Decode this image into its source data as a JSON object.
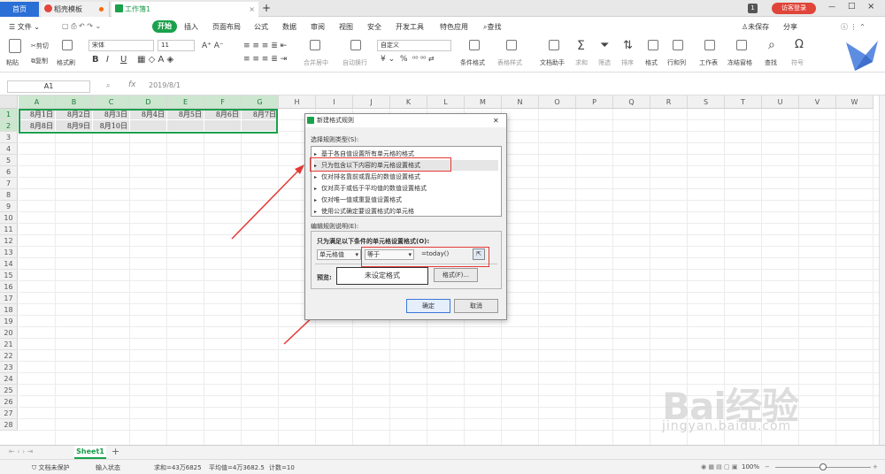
{
  "tabs": {
    "home": "首页",
    "t1": "稻壳模板",
    "t2": "工作簿1",
    "close": "×",
    "add": "+"
  },
  "topright": {
    "badge": "1",
    "login": "访客登录",
    "minimize": "—",
    "maximize": "□"
  },
  "menu": {
    "file": "文件",
    "start": "开始",
    "items": [
      "插入",
      "页面布局",
      "公式",
      "数据",
      "审阅",
      "视图",
      "安全",
      "开发工具",
      "特色应用"
    ],
    "search": "查找",
    "unsaved": "未保存",
    "share": "分享"
  },
  "ribbon": {
    "paste": "粘贴",
    "cut": "剪切",
    "copy": "复制",
    "format_painter": "格式刷",
    "font": "宋体",
    "size": "11",
    "bold": "B",
    "italic": "I",
    "underline": "U",
    "merge": "合并居中",
    "wrap": "自动换行",
    "numfmt": "自定义",
    "percent": "%",
    "cond": "条件格式",
    "table_style": "表格样式",
    "doc_helper": "文档助手",
    "sum": "求和",
    "filter": "筛选",
    "sort": "排序",
    "format": "格式",
    "rowcol": "行和列",
    "worksheet": "工作表",
    "freeze": "冻结窗格",
    "find": "查找",
    "symbol": "符号"
  },
  "formula_bar": {
    "cell_ref": "A1",
    "fx": "fx",
    "value": "2019/8/1"
  },
  "grid": {
    "columns": [
      "A",
      "B",
      "C",
      "D",
      "E",
      "F",
      "G",
      "H",
      "I",
      "J",
      "K",
      "L",
      "M",
      "N",
      "O",
      "P",
      "Q",
      "R",
      "S",
      "T",
      "U",
      "V",
      "W"
    ],
    "rows": [
      "1",
      "2",
      "3",
      "4",
      "5",
      "6",
      "7",
      "8",
      "9",
      "10",
      "11",
      "12",
      "13",
      "14",
      "15",
      "16",
      "17",
      "18",
      "19",
      "20",
      "21",
      "22",
      "23",
      "24",
      "25",
      "26",
      "27",
      "28"
    ],
    "row1": [
      "8月1日",
      "8月2日",
      "8月3日",
      "8月4日",
      "8月5日",
      "8月6日",
      "8月7日"
    ],
    "row2": [
      "8月8日",
      "8月9日",
      "8月10日"
    ]
  },
  "dialog": {
    "title": "新建格式规则",
    "close": "✕",
    "select_label": "选择规则类型(S):",
    "rules": [
      "基于各自值设置所有单元格的格式",
      "只为包含以下内容的单元格设置格式",
      "仅对排名靠前或靠后的数值设置格式",
      "仅对高于或低于平均值的数值设置格式",
      "仅对唯一值或重复值设置格式",
      "使用公式确定要设置格式的单元格"
    ],
    "edit_label": "编辑规则说明(E):",
    "cond_label": "只为满足以下条件的单元格设置格式(O):",
    "dd1": "单元格值",
    "dd2": "等于",
    "formula": "=today()",
    "preview_label": "预览:",
    "preview_text": "未设定格式",
    "format_btn": "格式(F)...",
    "ok": "确定",
    "cancel": "取消"
  },
  "sheetbar": {
    "sheet": "Sheet1",
    "add": "+"
  },
  "status": {
    "protect": "文档未保护",
    "input": "输入状态",
    "sum": "求和=43万6825",
    "avg": "平均值=4万3682.5",
    "count": "计数=10",
    "zoom": "100%"
  },
  "watermark": {
    "brand": "Bai经验",
    "url": "jingyan.baidu.com"
  },
  "colors": {
    "accent": "#1aa14c",
    "tab_home": "#2a6fd6",
    "annotation": "#e53935",
    "login": "#e0453a"
  }
}
